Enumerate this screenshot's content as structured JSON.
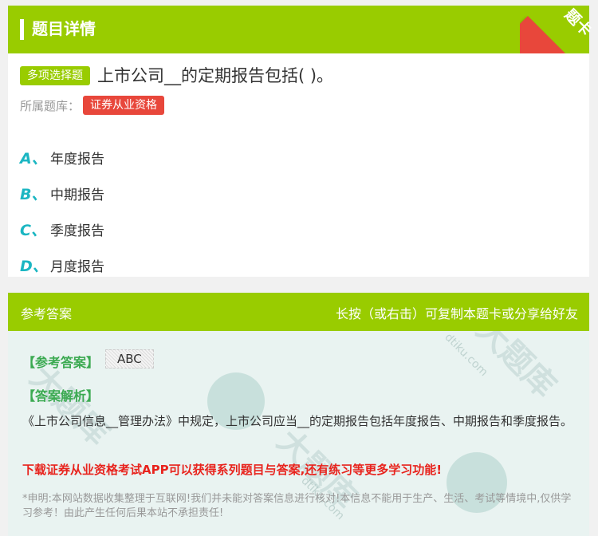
{
  "header": {
    "title": "题目详情",
    "ribbon_label": "题卡"
  },
  "question": {
    "type_badge": "多项选择题",
    "text": "上市公司__的定期报告包括( )。",
    "bank_label": "所属题库：",
    "bank_name": "证券从业资格",
    "options": [
      {
        "letter": "A、",
        "text": "年度报告"
      },
      {
        "letter": "B、",
        "text": "中期报告"
      },
      {
        "letter": "C、",
        "text": "季度报告"
      },
      {
        "letter": "D、",
        "text": "月度报告"
      }
    ]
  },
  "answer": {
    "head_left": "参考答案",
    "head_right": "长按（或右击）可复制本题卡或分享给好友",
    "answer_label": "【参考答案】",
    "answer_value": "ABC",
    "analysis_label": "【答案解析】",
    "analysis_text": "《上市公司信息__管理办法》中规定，上市公司应当__的定期报告包括年度报告、中期报告和季度报告。",
    "promo": "下载证券从业资格考试APP可以获得系列题目与答案,还有练习等更多学习功能!",
    "disclaimer": "*申明:本网站数据收集整理于互联网!我们并未能对答案信息进行核对!本信息不能用于生产、生活、考试等情境中,仅供学习参考！由此产生任何后果本站不承担责任!"
  },
  "watermark": {
    "brand": "大题库",
    "domain": "dtiku.com"
  },
  "colors": {
    "accent_green": "#99cc00",
    "ribbon_red": "#e8473b",
    "option_teal": "#1bb6c2",
    "label_green": "#3caa52",
    "promo_red": "#e8231d"
  }
}
